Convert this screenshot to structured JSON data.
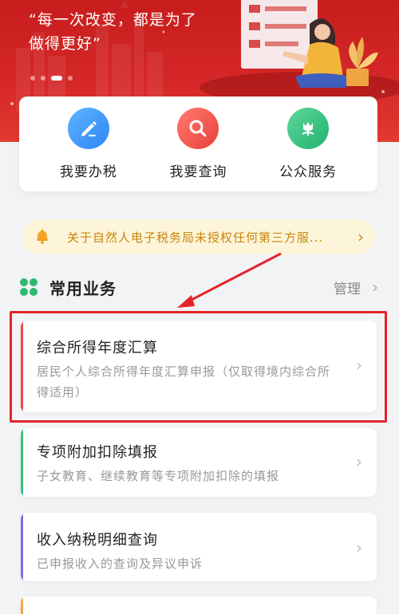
{
  "banner": {
    "slogan_line1": "“每一次改变，都是为了",
    "slogan_line2": "做得更好”",
    "dots_total": 4,
    "dots_active_index": 2
  },
  "quick_entries": [
    {
      "label": "我要办税",
      "icon": "pen-icon",
      "color": "#2e86f5"
    },
    {
      "label": "我要查询",
      "icon": "magnifier-icon",
      "color": "#e8403a"
    },
    {
      "label": "公众服务",
      "icon": "tulip-icon",
      "color": "#21b26f"
    }
  ],
  "notice": {
    "text": "关于自然人电子税务局未授权任何第三方服...",
    "icon": "bell-icon"
  },
  "section": {
    "title": "常用业务",
    "manage_label": "管理",
    "icon": "grid-icon"
  },
  "services": [
    {
      "title": "综合所得年度汇算",
      "desc": "居民个人综合所得年度汇算申报（仅取得境内综合所得适用）",
      "accent": "#e84a4a"
    },
    {
      "title": "专项附加扣除填报",
      "desc": "子女教育、继续教育等专项附加扣除的填报",
      "accent": "#39c27f"
    },
    {
      "title": "收入纳税明细查询",
      "desc": "已申报收入的查询及异议申诉",
      "accent": "#7d6ae8"
    },
    {
      "title": "",
      "desc": "",
      "accent": "#f0a640"
    }
  ],
  "annotation": {
    "highlight_color": "#e3242b"
  }
}
